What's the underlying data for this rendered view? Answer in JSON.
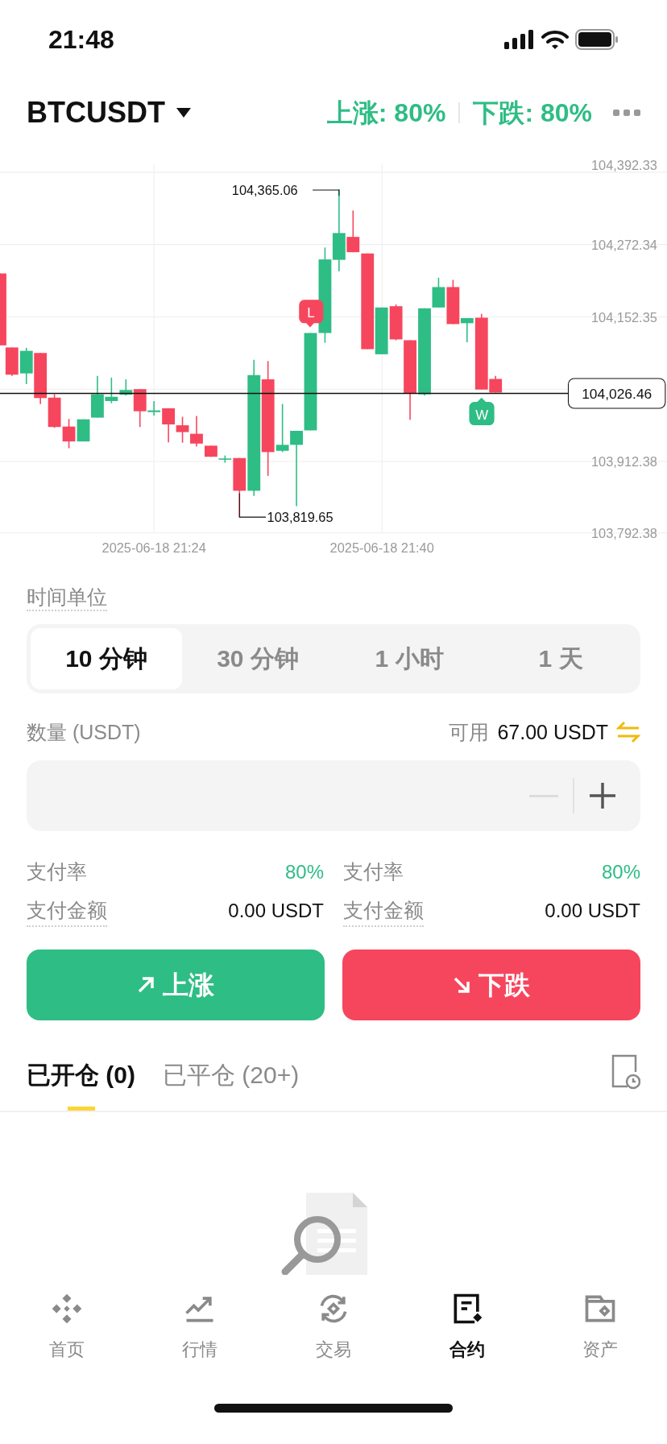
{
  "status_bar": {
    "time": "21:48"
  },
  "header": {
    "symbol": "BTCUSDT",
    "up_rate": "上涨: 80%",
    "down_rate": "下跌: 80%"
  },
  "chart": {
    "y_labels": [
      "104,392.33",
      "104,272.34",
      "104,152.35",
      "103,912.38",
      "103,792.38"
    ],
    "x_labels": [
      "2025-06-18 21:24",
      "2025-06-18 21:40"
    ],
    "high_label": "104,365.06",
    "low_label": "103,819.65",
    "price_label": "104,026.46",
    "markers": [
      {
        "kind": "loss",
        "text": "L"
      },
      {
        "kind": "win",
        "text": "W"
      }
    ]
  },
  "time_unit": {
    "label": "时间单位",
    "options": [
      {
        "label": "10 分钟",
        "selected": true
      },
      {
        "label": "30 分钟",
        "selected": false
      },
      {
        "label": "1 小时",
        "selected": false
      },
      {
        "label": "1 天",
        "selected": false
      }
    ]
  },
  "amount": {
    "label": "数量 (USDT)",
    "available_label": "可用",
    "available_value": "67.00 USDT",
    "minus_disabled": true
  },
  "payouts": [
    {
      "rate_label": "支付率",
      "rate": "80%",
      "amount_label": "支付金额",
      "amount": "0.00 USDT"
    },
    {
      "rate_label": "支付率",
      "rate": "80%",
      "amount_label": "支付金额",
      "amount": "0.00 USDT"
    }
  ],
  "actions": [
    {
      "kind": "up",
      "label": "上涨"
    },
    {
      "kind": "down",
      "label": "下跌"
    }
  ],
  "position_tabs": [
    {
      "label": "已开仓 (0)",
      "selected": true
    },
    {
      "label": "已平仓 (20+)",
      "selected": false
    }
  ],
  "bottom_nav": [
    {
      "kind": "home",
      "label": "首页",
      "selected": false
    },
    {
      "kind": "markets",
      "label": "行情",
      "selected": false
    },
    {
      "kind": "trade",
      "label": "交易",
      "selected": false
    },
    {
      "kind": "contract",
      "label": "合约",
      "selected": true
    },
    {
      "kind": "assets",
      "label": "资产",
      "selected": false
    }
  ]
}
